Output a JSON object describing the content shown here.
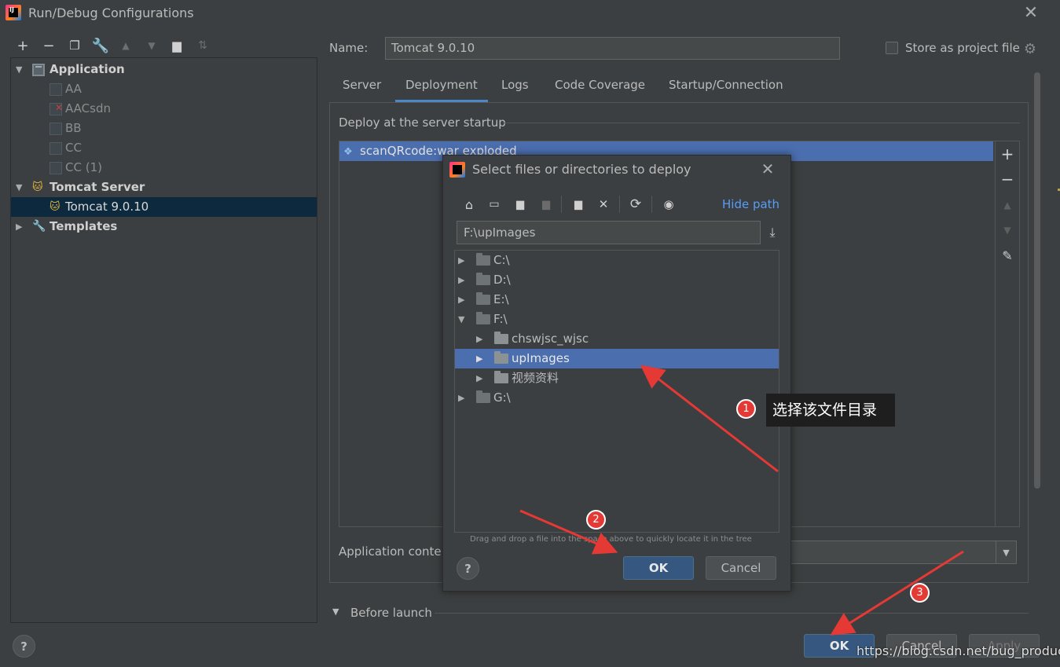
{
  "window": {
    "title": "Run/Debug Configurations"
  },
  "tree": {
    "groups": [
      {
        "label": "Application",
        "children": [
          "AA",
          "AACsdn",
          "BB",
          "CC",
          "CC (1)"
        ]
      },
      {
        "label": "Tomcat Server",
        "children": [
          "Tomcat 9.0.10"
        ]
      },
      {
        "label": "Templates",
        "children": []
      }
    ]
  },
  "config": {
    "name_label": "Name:",
    "name_value": "Tomcat 9.0.10",
    "store_label": "Store as project file"
  },
  "tabs": [
    "Server",
    "Deployment",
    "Logs",
    "Code Coverage",
    "Startup/Connection"
  ],
  "active_tab": "Deployment",
  "deployment": {
    "heading": "Deploy at the server startup",
    "items": [
      "scanQRcode:war exploded"
    ],
    "context_label": "Application conte"
  },
  "before_launch": "Before launch",
  "buttons": {
    "ok": "OK",
    "cancel": "Cancel",
    "apply": "Apply",
    "help": "?"
  },
  "dialog": {
    "title": "Select files or directories to deploy",
    "hide_path": "Hide path",
    "path": "F:\\upImages",
    "tree": [
      {
        "label": "C:\\",
        "level": 0,
        "expanded": false
      },
      {
        "label": "D:\\",
        "level": 0,
        "expanded": false
      },
      {
        "label": "E:\\",
        "level": 0,
        "expanded": false
      },
      {
        "label": "F:\\",
        "level": 0,
        "expanded": true
      },
      {
        "label": "chswjsc_wjsc",
        "level": 1,
        "expanded": false
      },
      {
        "label": "upImages",
        "level": 1,
        "expanded": false,
        "selected": true
      },
      {
        "label": "视频资料",
        "level": 1,
        "expanded": false
      },
      {
        "label": "G:\\",
        "level": 0,
        "expanded": false
      }
    ],
    "drop_hint": "Drag and drop a file into the space above to quickly locate it in the tree",
    "ok": "OK",
    "cancel": "Cancel",
    "help": "?"
  },
  "annotations": {
    "badges": [
      "1",
      "2",
      "3"
    ],
    "callout": "选择该文件目录",
    "watermark": "https://blog.csdn.net/bug_producter"
  },
  "colors": {
    "background": "#3c3f41",
    "selection": "#4b6eaf",
    "primary_button": "#365880",
    "link": "#589df6",
    "annotation": "#e53935"
  }
}
